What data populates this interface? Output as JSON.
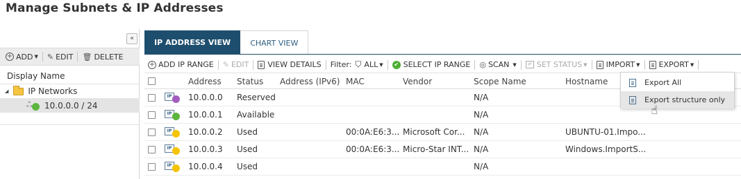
{
  "page": {
    "title": "Manage Subnets & IP Addresses"
  },
  "left": {
    "collapse_icon": "double-chevron-left-icon",
    "toolbar": {
      "add": "ADD",
      "edit": "EDIT",
      "delete": "DELETE"
    },
    "header": "Display Name",
    "tree": {
      "root": "IP Networks",
      "child": "10.0.0.0 / 24",
      "child_status_color": "#5cb53d"
    }
  },
  "tabs": {
    "active": "IP ADDRESS VIEW",
    "inactive": "CHART VIEW"
  },
  "toolbar": {
    "add_ip_range": "ADD IP RANGE",
    "edit": "EDIT",
    "view_details": "VIEW DETAILS",
    "filter_label": "Filter:",
    "filter_value": "ALL",
    "select_ip_range": "SELECT IP RANGE",
    "scan": "SCAN",
    "set_status": "SET STATUS",
    "import": "IMPORT",
    "export": "EXPORT"
  },
  "columns": {
    "address": "Address",
    "status": "Status",
    "ipv6": "Address (IPv6)",
    "mac": "MAC",
    "vendor": "Vendor",
    "scope": "Scope Name",
    "hostname": "Hostname"
  },
  "rows": [
    {
      "address": "10.0.0.0",
      "status": "Reserved",
      "mac": "",
      "vendor": "",
      "scope": "N/A",
      "hostname": "",
      "color": "#a25cbf"
    },
    {
      "address": "10.0.0.1",
      "status": "Available",
      "mac": "",
      "vendor": "",
      "scope": "N/A",
      "hostname": "",
      "color": "#5cb53d"
    },
    {
      "address": "10.0.0.2",
      "status": "Used",
      "mac": "00:0A:E6:3...",
      "vendor": "Microsoft Cor...",
      "scope": "N/A",
      "hostname": "UBUNTU-01.Impo...",
      "color": "#f5c400"
    },
    {
      "address": "10.0.0.3",
      "status": "Used",
      "mac": "00:0A:E6:3...",
      "vendor": "Micro-Star INT...",
      "scope": "N/A",
      "hostname": "Windows.ImportS...",
      "color": "#f5c400"
    },
    {
      "address": "10.0.0.4",
      "status": "Used",
      "mac": "",
      "vendor": "",
      "scope": "N/A",
      "hostname": "",
      "color": "#f5c400"
    }
  ],
  "export_menu": {
    "items": [
      "Export All",
      "Export structure only"
    ]
  },
  "ip_icon_text": "IP"
}
